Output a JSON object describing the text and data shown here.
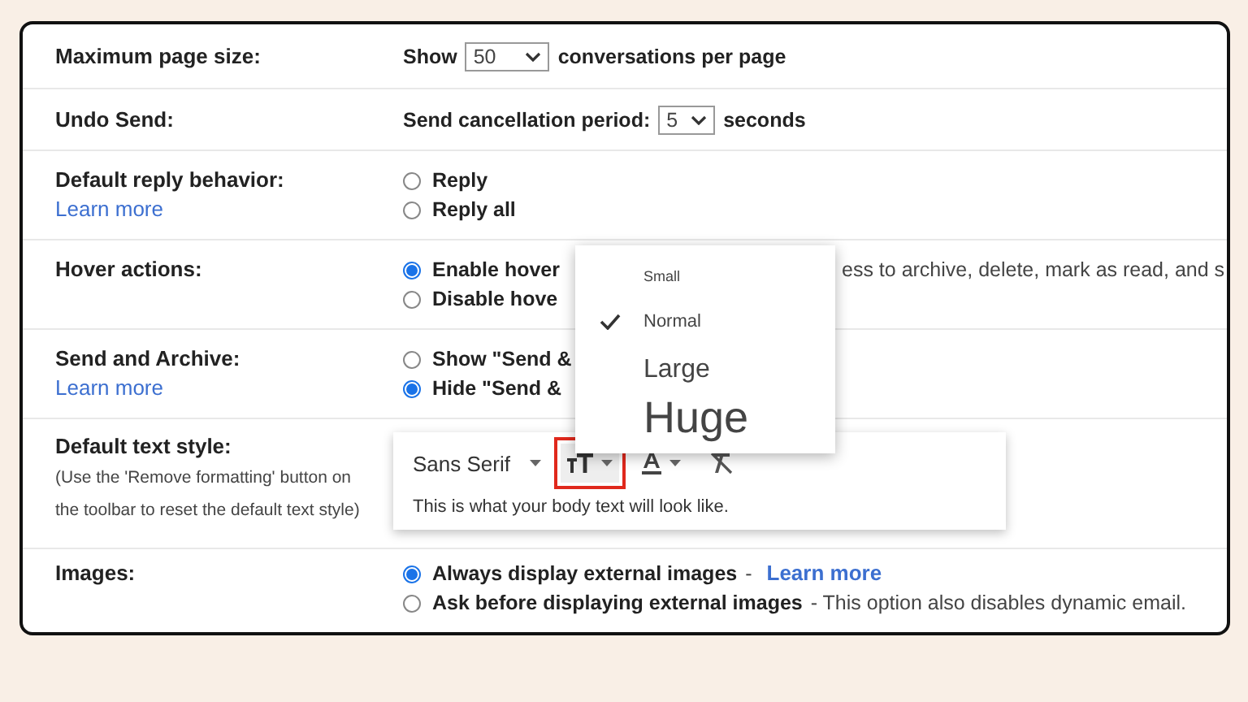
{
  "settings": [
    {
      "kind": "select",
      "label": "Maximum page size:",
      "before": "Show",
      "value": "50",
      "after": "conversations per page"
    },
    {
      "kind": "select",
      "label": "Undo Send:",
      "before": "Send cancellation period:",
      "value": "5",
      "after": "seconds"
    },
    {
      "kind": "radios",
      "label": "Default reply behavior:",
      "link": "Learn more",
      "options": [
        {
          "label": "Reply",
          "selected": false
        },
        {
          "label": "Reply all",
          "selected": false
        }
      ]
    },
    {
      "kind": "radios",
      "label": "Hover actions:",
      "options": [
        {
          "label": "Enable hover",
          "selected": true,
          "hint": "ess to archive, delete, mark as read, and s"
        },
        {
          "label": "Disable hove",
          "selected": false
        }
      ]
    },
    {
      "kind": "radios",
      "label": "Send and Archive:",
      "link": "Learn more",
      "options": [
        {
          "label": "Show \"Send &",
          "selected": false
        },
        {
          "label": "Hide \"Send &",
          "selected": true
        }
      ]
    },
    {
      "kind": "text_style",
      "label": "Default text style:",
      "note_lines": [
        "(Use the 'Remove formatting' button on",
        "the toolbar to reset the default text style)"
      ],
      "font": "Sans Serif",
      "size_button": {
        "highlighted": true
      },
      "preview": "This is what your body text will look like."
    },
    {
      "kind": "radios",
      "label": "Images:",
      "options": [
        {
          "label": "Always display external images",
          "selected": true,
          "hint": "-",
          "link": "Learn more"
        },
        {
          "label": "Ask before displaying external images",
          "selected": false,
          "hint": "- This option also disables dynamic email."
        }
      ]
    }
  ],
  "size_menu": {
    "items": [
      {
        "label": "Small",
        "selected": false
      },
      {
        "label": "Normal",
        "selected": true
      },
      {
        "label": "Large",
        "selected": false
      },
      {
        "label": "Huge",
        "selected": false
      }
    ]
  }
}
